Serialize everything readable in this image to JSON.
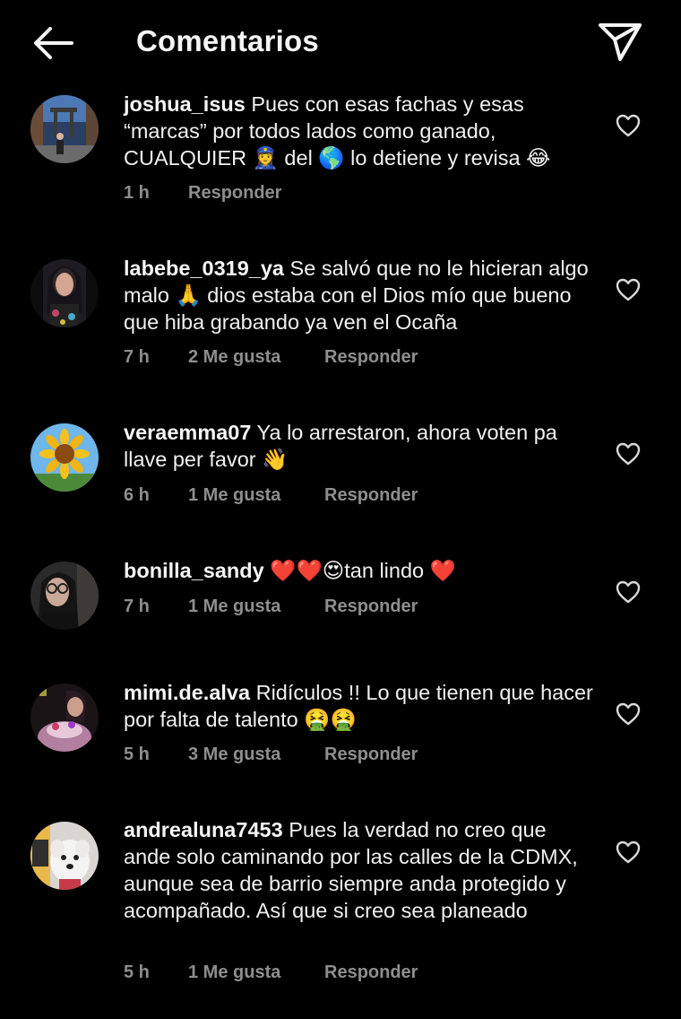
{
  "header": {
    "title": "Comentarios"
  },
  "comments": [
    {
      "username": "joshua_isus",
      "text": "Pues con esas fachas y esas “marcas” por todos lados como ganado, CUALQUIER 👮‍♀️ del 🌎 lo detiene y revisa 😂",
      "time": "1 h",
      "likes": "",
      "reply": "Responder"
    },
    {
      "username": "labebe_0319_ya",
      "text": "Se salvó que no le hicieran algo malo 🙏 dios estaba con el Dios mío que bueno que hiba grabando ya ven el Ocaña",
      "time": "7 h",
      "likes": "2 Me gusta",
      "reply": "Responder"
    },
    {
      "username": "veraemma07",
      "text": "Ya lo arrestaron, ahora voten pa llave per favor 👋",
      "time": "6 h",
      "likes": "1 Me gusta",
      "reply": "Responder"
    },
    {
      "username": "bonilla_sandy",
      "text": "❤️❤️😍tan lindo ❤️",
      "time": "7 h",
      "likes": "1 Me gusta",
      "reply": "Responder"
    },
    {
      "username": "mimi.de.alva",
      "text": "Ridículos !! Lo que tienen que hacer por falta de talento 🤮🤮",
      "time": "5 h",
      "likes": "3 Me gusta",
      "reply": "Responder"
    },
    {
      "username": "andrealuna7453",
      "text": "Pues la verdad no creo que ande solo caminando por las calles de la CDMX, aunque sea de barrio siempre anda protegido y acompañado. Así que si creo sea planeado",
      "time": "5 h",
      "likes": "1 Me gusta",
      "reply": "Responder"
    }
  ],
  "icons": {
    "back": "arrow-left-icon",
    "share": "paper-plane-icon",
    "like": "heart-outline-icon"
  },
  "colors": {
    "background": "#000000",
    "text": "#f5f5f5",
    "muted": "#8e8e8e"
  }
}
